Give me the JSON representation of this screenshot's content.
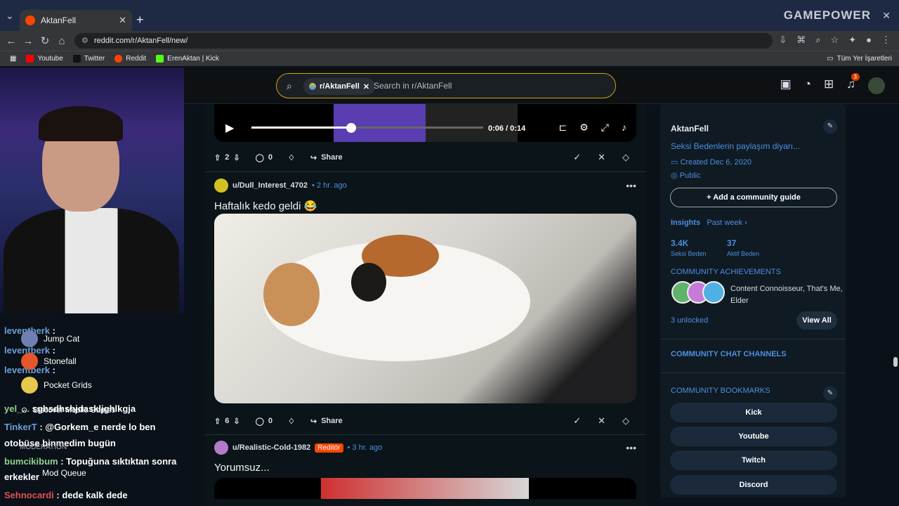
{
  "browser": {
    "tab_title": "AktanFell",
    "url": "reddit.com/r/AktanFell/new/",
    "bookmarks": [
      "Youtube",
      "Twitter",
      "Reddit",
      "ErenAktan | Kick"
    ],
    "bookmark_colors": [
      "#ff0000",
      "#111111",
      "#ff4500",
      "#53fc18"
    ],
    "all_bookmarks": "Tüm Yer İşaretleri",
    "overlay_brand": "GAMEPOWER"
  },
  "reddit": {
    "search_chip": "r/AktanFell",
    "search_placeholder": "Search in r/AktanFell",
    "notifications": "3"
  },
  "video1": {
    "time": "0:06 / 0:14",
    "progress": 0.43
  },
  "post1_actions": {
    "votes": "2",
    "comments": "0",
    "share": "Share"
  },
  "post2": {
    "user": "u/Dull_Interest_4702",
    "age": "• 2 hr. ago",
    "title": "Haftalık kedo geldi 😂",
    "votes": "6",
    "comments": "0",
    "share": "Share"
  },
  "post3": {
    "user": "u/Realistic-Cold-1982",
    "flair": "Reditör",
    "age": "• 3 hr. ago",
    "title": "Yorumsuz..."
  },
  "sidebar": {
    "name": "AktanFell",
    "desc": "Seksi Bedenlerin paylaşım diyarı...",
    "created": "Created Dec 6, 2020",
    "visibility": "Public",
    "guide": "+ Add a community guide",
    "insights": "Insights",
    "period": "Past week ›",
    "stat1_value": "3.4K",
    "stat1_label": "Seksi Beden",
    "stat2_value": "37",
    "stat2_label": "Aktif Beden",
    "achievements_title": "COMMUNITY ACHIEVEMENTS",
    "achievements": "Content Connoisseur, That's Me, Elder",
    "unlocked": "3 unlocked",
    "view_all": "View All",
    "chat_channels": "COMMUNITY CHAT CHANNELS",
    "bookmarks_title": "COMMUNITY BOOKMARKS",
    "bookmarks": [
      "Kick",
      "Youtube",
      "Twitch",
      "Discord"
    ]
  },
  "stream_chat": {
    "lines": [
      {
        "user": "leventberk",
        "text": " :"
      },
      {
        "user": "leventberk",
        "text": " :"
      },
      {
        "user": "leventberk",
        "text": " :"
      },
      {
        "user": "yel_...",
        "text": "sghsdhshjdaskljghlkgja"
      },
      {
        "user": "TinkerT",
        "text": " : @Gorkem_e nerde lo ben"
      },
      {
        "user": "",
        "text": "otobüse binmedim bugün"
      },
      {
        "user": "bumcikibum",
        "text": " : Topuğuna sıktıktan sonra"
      },
      {
        "user": "",
        "text": "erkekler"
      },
      {
        "user": "Sehnocardi",
        "text": " : dede kalk dede"
      }
    ],
    "games": [
      "Jump Cat",
      "Stonefall",
      "Pocket Grids",
      "Discover Mobile Games"
    ],
    "moderation": "MODERATION",
    "mod_queue": "Mod Queue"
  }
}
